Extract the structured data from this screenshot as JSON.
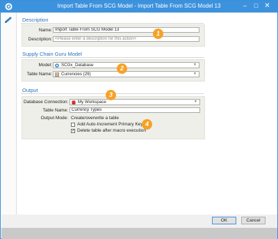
{
  "window": {
    "title": "Import Table From SCG Model - Import Table From SCG Model 13",
    "minimize_glyph": "–",
    "maximize_glyph": "□",
    "close_glyph": "✕"
  },
  "description": {
    "section_title": "Description",
    "name_label": "Name:",
    "name_value": "Import Table From SCG Model 13",
    "description_label": "Description:",
    "description_placeholder": "<Please enter a description for this action>"
  },
  "model_section": {
    "section_title": "Supply Chain Guru Model",
    "model_label": "Model:",
    "model_value": "SCGx_Database",
    "table_label": "Table Name:",
    "table_value": "Currencies (29)"
  },
  "output": {
    "section_title": "Output",
    "db_label": "Database Connection:",
    "db_value": "My Workspace",
    "table_name_label": "Table Name:",
    "table_name_value": "Currency Types",
    "mode_label": "Output Mode:",
    "mode_value": "Create/overwrite a table",
    "checkbox_auto_label": "Add Auto-Increment Primary Key",
    "checkbox_auto_checked": false,
    "checkbox_delete_label": "Delete table after macro execution",
    "checkbox_delete_checked": true
  },
  "badges": [
    "1",
    "2",
    "3",
    "4"
  ],
  "buttons": {
    "ok": "OK",
    "cancel": "Cancel"
  },
  "colors": {
    "titlebar": "#3d92dd",
    "section_title": "#2a6fba",
    "badge": "#f6a227",
    "panel": "#efefe9"
  }
}
